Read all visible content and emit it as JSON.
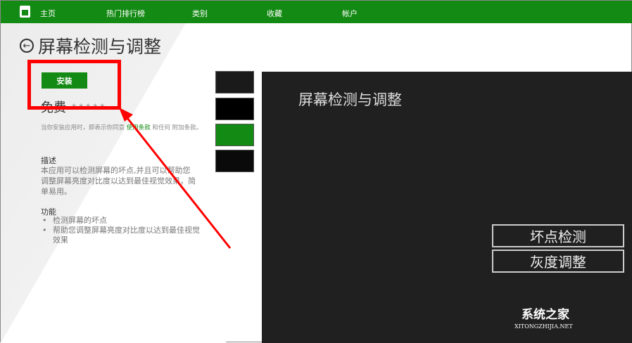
{
  "nav": {
    "items": [
      "主页",
      "热门排行榜",
      "类别",
      "收藏",
      "帐户"
    ]
  },
  "app": {
    "title": "屏幕检测与调整",
    "install_label": "安装",
    "price": "免费",
    "stars": "★★★★★",
    "terms_prefix": "当你安装应用时，即表示你同意 ",
    "terms_link": "使用条款",
    "terms_suffix": " 和任何 附加条款。",
    "desc_heading": "描述",
    "description": "本应用可以检测屏幕的坏点,并且可以帮助您调整屏幕亮度对比度以达到最佳视觉效果，简单易用。",
    "features_heading": "功能",
    "features": [
      "检测屏幕的坏点",
      "帮助您调整屏幕亮度对比度以达到最佳视觉效果"
    ]
  },
  "preview": {
    "title": "屏幕检测与调整",
    "buttons": [
      "坏点检测",
      "灰度调整"
    ]
  },
  "watermark": {
    "name": "系统之家",
    "url": "XITONGZHIJIA.NET"
  },
  "colors": {
    "accent": "#138a13",
    "annotation": "#ff0000"
  }
}
